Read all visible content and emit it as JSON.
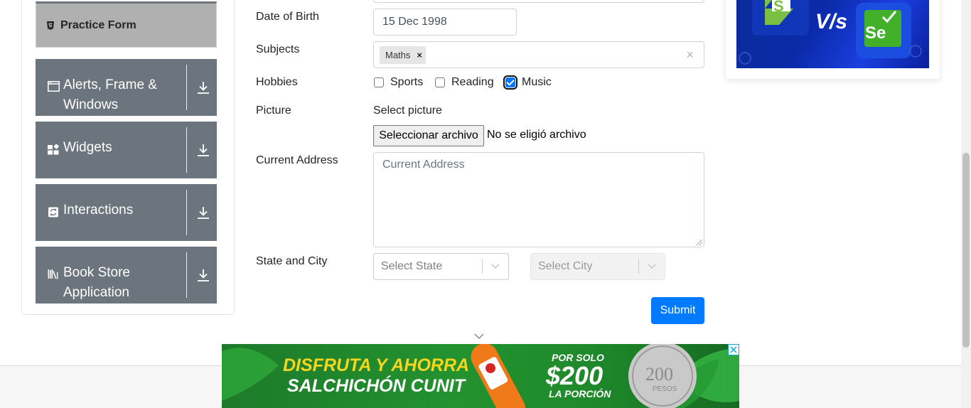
{
  "sidebar": {
    "active_item": {
      "label": "Practice Form",
      "icon": "html5-icon"
    },
    "groups": [
      {
        "label_lines": [
          "Alerts, Frame &",
          "Windows"
        ],
        "icon": "window-icon"
      },
      {
        "label_lines": [
          "Widgets"
        ],
        "icon": "widgets-icon"
      },
      {
        "label_lines": [
          "Interactions"
        ],
        "icon": "interactions-icon"
      },
      {
        "label_lines": [
          "Book Store",
          "Application"
        ],
        "icon": "books-icon"
      }
    ]
  },
  "form": {
    "dob_label": "Date of Birth",
    "dob_value": "15 Dec 1998",
    "subjects_label": "Subjects",
    "subjects": [
      "Maths"
    ],
    "subjects_remove": "×",
    "subjects_clear": "×",
    "hobbies_label": "Hobbies",
    "hobbies": [
      {
        "label": "Sports",
        "checked": false
      },
      {
        "label": "Reading",
        "checked": false
      },
      {
        "label": "Music",
        "checked": true
      }
    ],
    "picture_label": "Picture",
    "picture_prompt": "Select picture",
    "file_button": "Seleccionar archivo",
    "file_status": "No se eligió archivo",
    "address_label": "Current Address",
    "address_placeholder": "Current Address",
    "state_city_label": "State and City",
    "state_placeholder": "Select State",
    "city_placeholder": "Select City",
    "submit_label": "Submit"
  },
  "ads": {
    "right_ad_text": {
      "vs": "V/s",
      "left_logo": "S",
      "right_logo": "Se"
    },
    "bottom_ad": {
      "line1": "DISFRUTA Y AHORRA",
      "line2": "SALCHICHÓN CUNIT",
      "price_prefix": "POR SOLO",
      "price": "$200",
      "price_suffix": "LA PORCIÓN",
      "coin_value": "200",
      "coin_unit": "PESOS"
    }
  },
  "colors": {
    "primary": "#007bff",
    "sidebar_group": "#6c757d",
    "sidebar_active": "#b0b0b0",
    "checkbox_checked": "#0075ff",
    "ad_green": "#23922f",
    "ad_blue": "#0b2d9a"
  }
}
